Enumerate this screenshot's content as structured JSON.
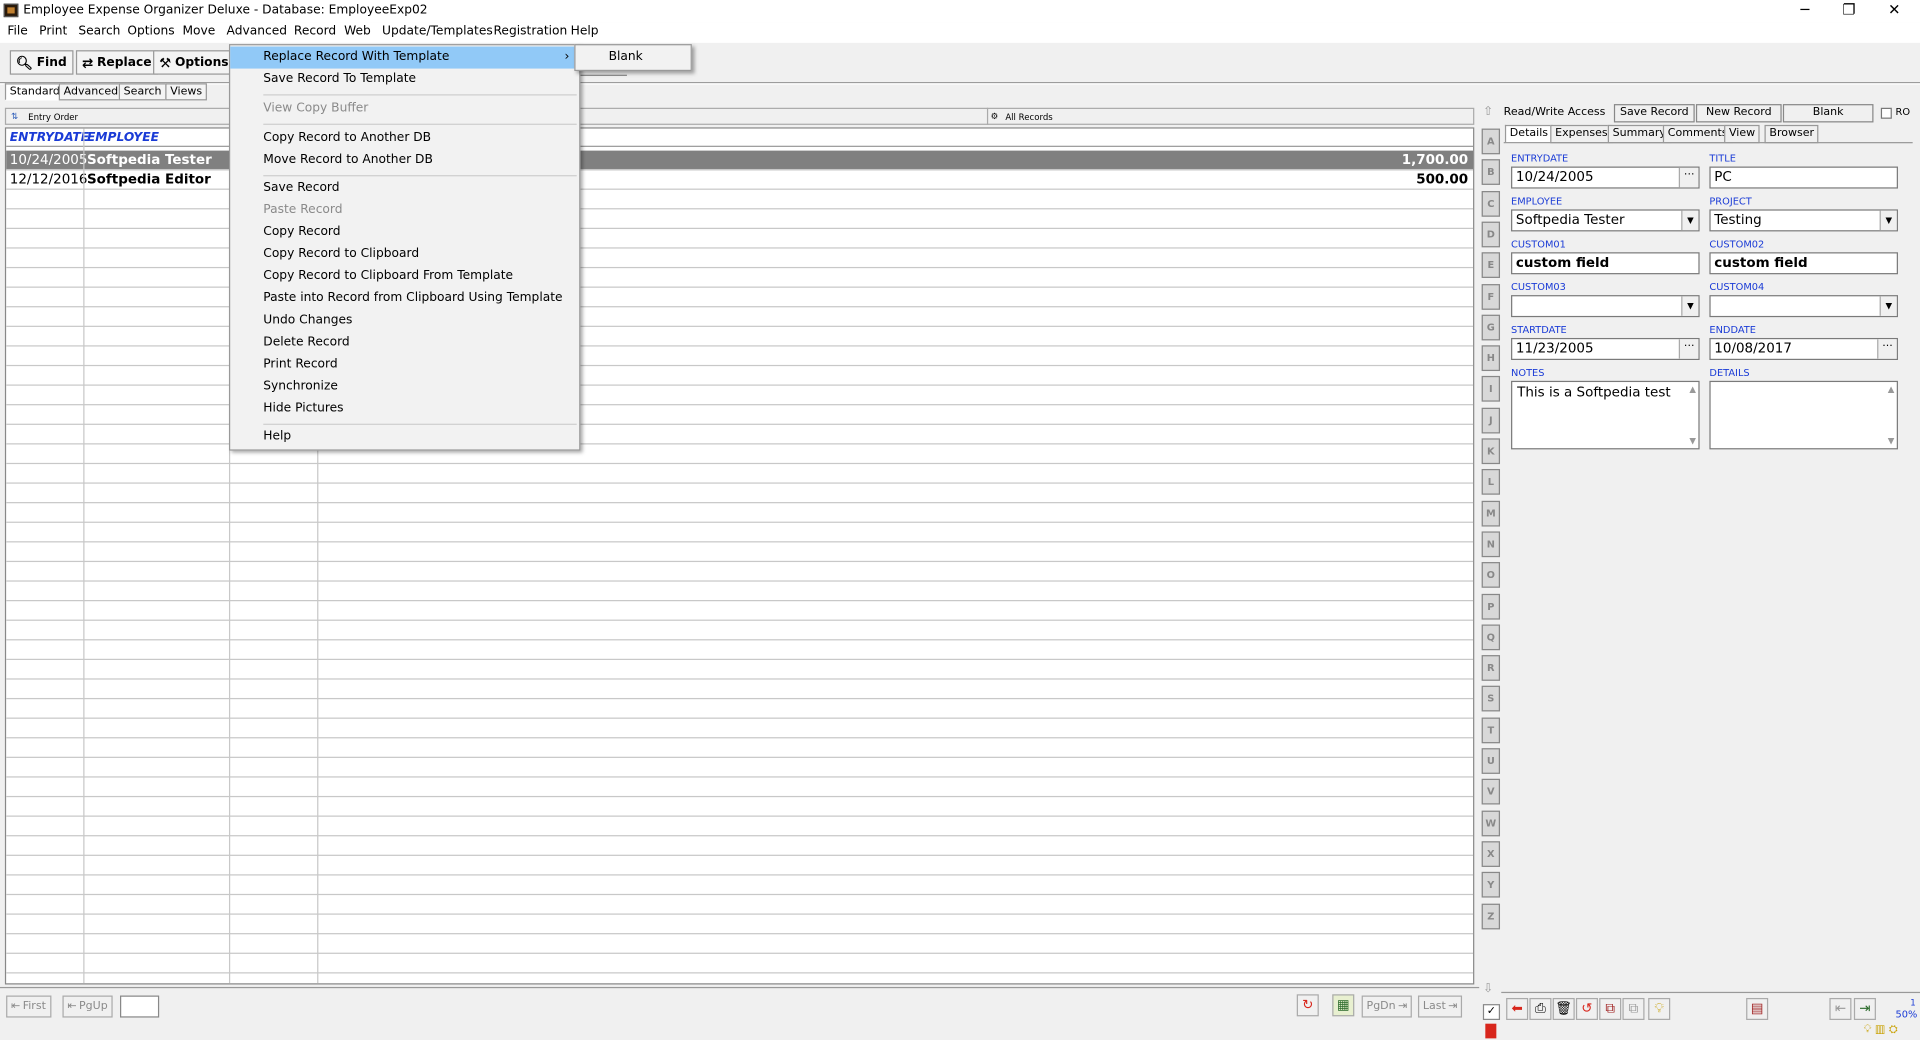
{
  "window": {
    "title": "Employee Expense Organizer Deluxe - Database: EmployeeExp02",
    "minimize": "─",
    "restore": "❐",
    "close": "✕"
  },
  "menubar": [
    "File",
    "Print",
    "Search",
    "Options",
    "Move",
    "Advanced",
    "Record",
    "Web",
    "Update/Templates",
    "Registration",
    "Help"
  ],
  "toolbar": {
    "find": "Find",
    "replace": "Replace",
    "options": "Options"
  },
  "view_tabs": [
    "Standard",
    "Advanced",
    "Search",
    "Views"
  ],
  "list": {
    "order_label": "Entry Order",
    "filter_label": "All Records",
    "columns": [
      "ENTRYDATE",
      "EMPLOYEE"
    ],
    "rows": [
      {
        "date": "10/24/2005",
        "employee": "Softpedia Tester",
        "amount": "1,700.00"
      },
      {
        "date": "12/12/2016",
        "employee": "Softpedia Editor",
        "amount": "500.00"
      }
    ]
  },
  "alphabet": [
    "A",
    "B",
    "C",
    "D",
    "E",
    "F",
    "G",
    "H",
    "I",
    "J",
    "K",
    "L",
    "M",
    "N",
    "O",
    "P",
    "Q",
    "R",
    "S",
    "T",
    "U",
    "V",
    "W",
    "X",
    "Y",
    "Z"
  ],
  "record_bar": {
    "access": "Read/Write Access",
    "save": "Save Record",
    "new": "New Record",
    "blank": "Blank",
    "ro": "RO"
  },
  "detail_tabs": [
    "Details",
    "Expenses",
    "Summary",
    "Comments",
    "View",
    "Browser"
  ],
  "fields": {
    "entrydate": {
      "label": "ENTRYDATE",
      "value": "10/24/2005"
    },
    "title": {
      "label": "TITLE",
      "value": "PC"
    },
    "employee": {
      "label": "EMPLOYEE",
      "value": "Softpedia Tester"
    },
    "project": {
      "label": "PROJECT",
      "value": "Testing"
    },
    "custom01": {
      "label": "CUSTOM01",
      "value": "custom field"
    },
    "custom02": {
      "label": "CUSTOM02",
      "value": "custom field"
    },
    "custom03": {
      "label": "CUSTOM03",
      "value": ""
    },
    "custom04": {
      "label": "CUSTOM04",
      "value": ""
    },
    "startdate": {
      "label": "STARTDATE",
      "value": "11/23/2005"
    },
    "enddate": {
      "label": "ENDDATE",
      "value": "10/08/2017"
    },
    "notes": {
      "label": "NOTES",
      "value": "This is a Softpedia test"
    },
    "details": {
      "label": "DETAILS",
      "value": ""
    }
  },
  "nav": {
    "first": "First",
    "pgup": "PgUp",
    "pgdn": "PgDn",
    "last": "Last",
    "zoom": "50%",
    "page": "1"
  },
  "record_menu": {
    "items": [
      {
        "label": "Replace Record With Template",
        "state": "highlight"
      },
      {
        "label": "Save Record To Template"
      },
      {
        "label": "View Copy Buffer",
        "state": "disabled"
      },
      {
        "label": "Copy Record to Another DB"
      },
      {
        "label": "Move Record to Another DB"
      },
      {
        "label": "Save Record"
      },
      {
        "label": "Paste Record",
        "state": "disabled"
      },
      {
        "label": "Copy Record"
      },
      {
        "label": "Copy Record to Clipboard"
      },
      {
        "label": "Copy Record to Clipboard From Template"
      },
      {
        "label": "Paste into Record from Clipboard Using Template"
      },
      {
        "label": "Undo Changes"
      },
      {
        "label": "Delete Record"
      },
      {
        "label": "Print Record"
      },
      {
        "label": "Synchronize"
      },
      {
        "label": "Hide Pictures"
      },
      {
        "label": "Help"
      }
    ],
    "submenu_arrow": "›"
  },
  "submenu": {
    "items": [
      "Blank"
    ]
  }
}
